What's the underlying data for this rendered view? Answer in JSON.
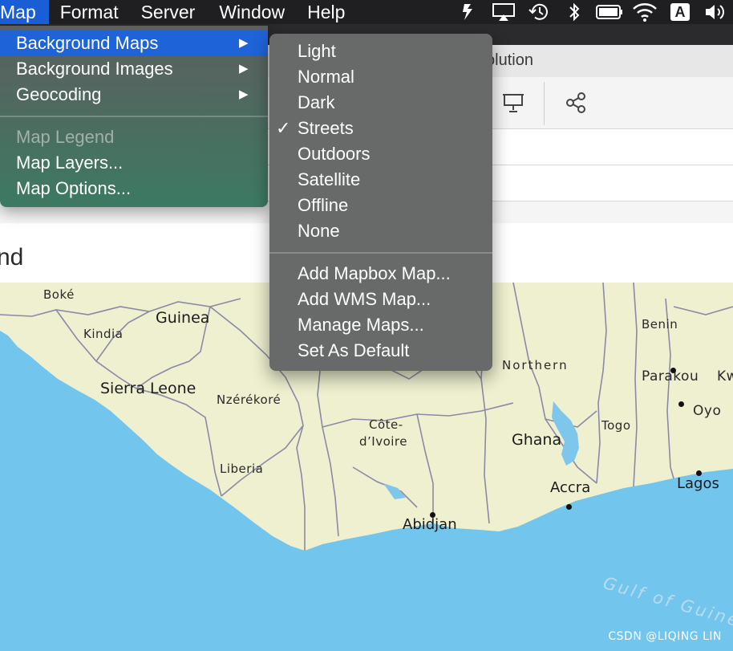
{
  "menubar": {
    "items": [
      {
        "label": "Map"
      },
      {
        "label": "Format"
      },
      {
        "label": "Server"
      },
      {
        "label": "Window"
      },
      {
        "label": "Help"
      }
    ],
    "status_icons": [
      "app-icon",
      "airplay-icon",
      "time-machine-icon",
      "bluetooth-icon",
      "battery-icon",
      "wifi-icon",
      "input-source-icon",
      "volume-icon"
    ],
    "input_source_label": "A"
  },
  "map_menu": {
    "items": [
      {
        "label": "Background Maps",
        "submenu": true,
        "highlighted": true
      },
      {
        "label": "Background Images",
        "submenu": true
      },
      {
        "label": "Geocoding",
        "submenu": true
      },
      {
        "label": "Map Legend",
        "disabled": true
      },
      {
        "label": "Map Layers..."
      },
      {
        "label": "Map Options..."
      }
    ],
    "arrow": "▶"
  },
  "background_maps_menu": {
    "items": [
      {
        "label": "Light"
      },
      {
        "label": "Normal"
      },
      {
        "label": "Dark"
      },
      {
        "label": "Streets",
        "checked": true
      },
      {
        "label": "Outdoors"
      },
      {
        "label": "Satellite"
      },
      {
        "label": "Offline"
      },
      {
        "label": "None"
      },
      {
        "label": "Add Mapbox Map..."
      },
      {
        "label": "Add WMS Map..."
      },
      {
        "label": "Manage Maps..."
      },
      {
        "label": "Set As Default"
      }
    ],
    "check_mark": "✓"
  },
  "window": {
    "title_fragment": "olution",
    "headline_fragment": "nd"
  },
  "map": {
    "labels": {
      "boke": "Boké",
      "guinea": "Guinea",
      "kindia": "Kindia",
      "sierra_leone": "Sierra Leone",
      "nzerekore": "Nzérékoré",
      "liberia": "Liberia",
      "cote": "Côte-",
      "divoire": "d’Ivoire",
      "abidjan": "Abidjan",
      "northern": "Northern",
      "ghana": "Ghana",
      "accra": "Accra",
      "togo": "Togo",
      "benin": "Benin",
      "parakou": "Parakou",
      "kw": "Kw",
      "oyo": "Oyo",
      "lagos": "Lagos",
      "gulf": "Gulf of Guinea"
    },
    "colors": {
      "land": "#eef0cf",
      "sea": "#72c5ec",
      "border": "#8a8aa6",
      "lake": "#7fc6ec"
    }
  },
  "watermark": "CSDN @LIQING LIN"
}
